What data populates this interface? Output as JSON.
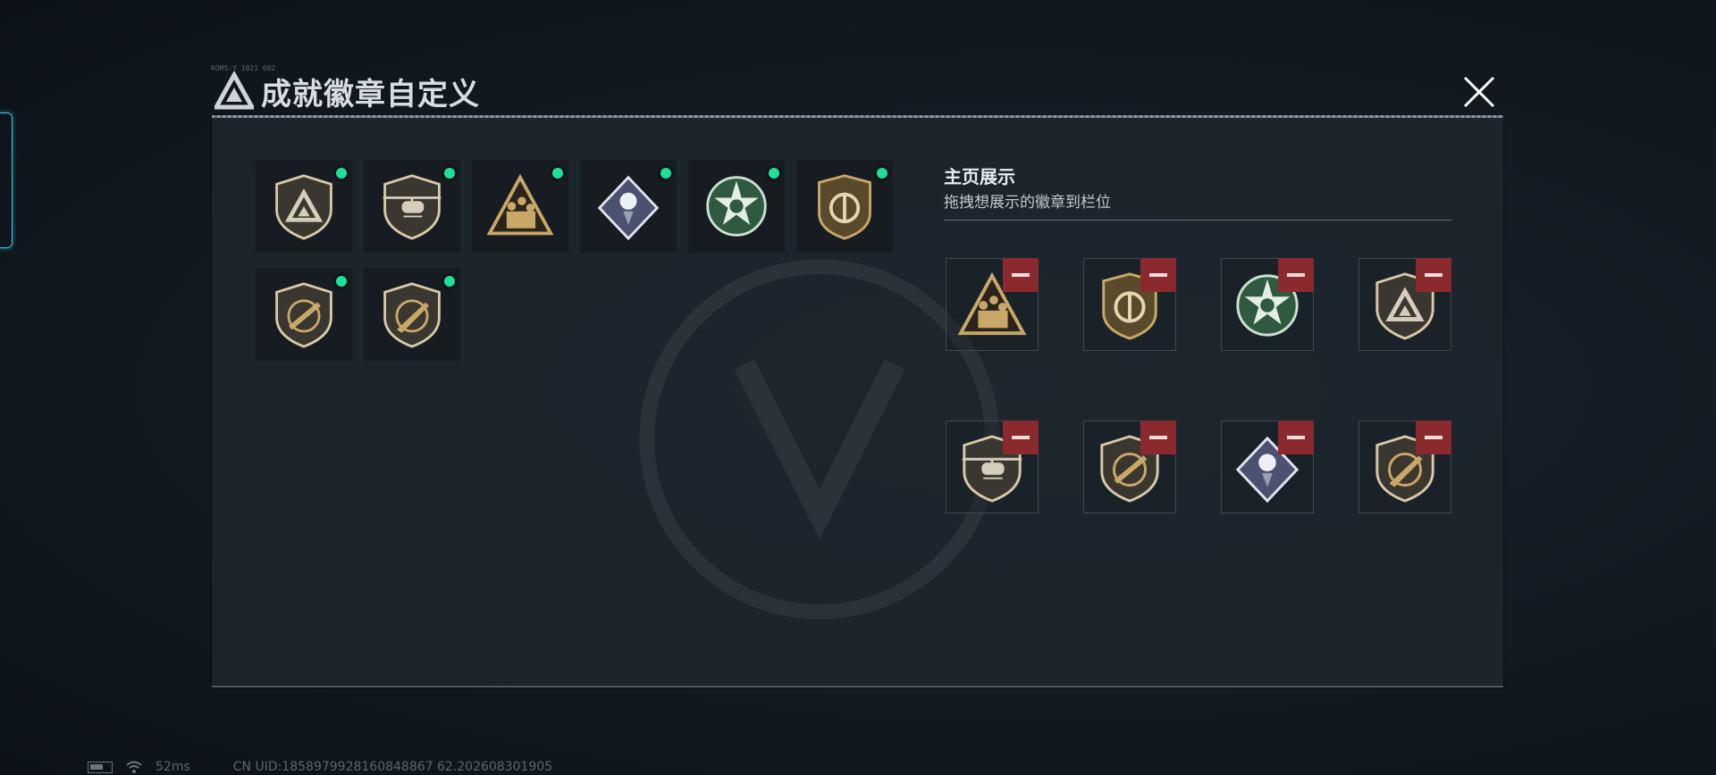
{
  "dialog": {
    "title": "成就徽章自定义",
    "header_small_text": "ROMS:Y 1021 002"
  },
  "inventory": {
    "badges": [
      {
        "icon": "shield-triangle-icon",
        "unlocked": true
      },
      {
        "icon": "helicopter-shield-icon",
        "unlocked": true
      },
      {
        "icon": "soldiers-triangle-icon",
        "unlocked": true
      },
      {
        "icon": "rose-diamond-icon",
        "unlocked": true
      },
      {
        "icon": "green-star-emblem-icon",
        "unlocked": true
      },
      {
        "icon": "split-crest-icon",
        "unlocked": true
      },
      {
        "icon": "rifle-shield-icon",
        "unlocked": true
      },
      {
        "icon": "knife-shield-icon",
        "unlocked": true
      }
    ]
  },
  "display": {
    "title": "主页展示",
    "subtitle": "拖拽想展示的徽章到栏位",
    "slots": [
      {
        "icon": "soldiers-triangle-icon"
      },
      {
        "icon": "split-crest-icon"
      },
      {
        "icon": "green-star-emblem-icon"
      },
      {
        "icon": "shield-triangle-icon"
      },
      {
        "icon": "helicopter-shield-icon"
      },
      {
        "icon": "rifle-shield-icon"
      },
      {
        "icon": "rose-diamond-icon"
      },
      {
        "icon": "knife-shield-icon"
      }
    ]
  },
  "status": {
    "ping": "52ms",
    "uid": "CN UID:1858979928160848867 62.202608301905"
  },
  "colors": {
    "accent_green": "#1fe098",
    "remove_red": "#8a2a2e",
    "side_tab_cyan": "#3ad0e8",
    "gold": "#c9a867"
  }
}
